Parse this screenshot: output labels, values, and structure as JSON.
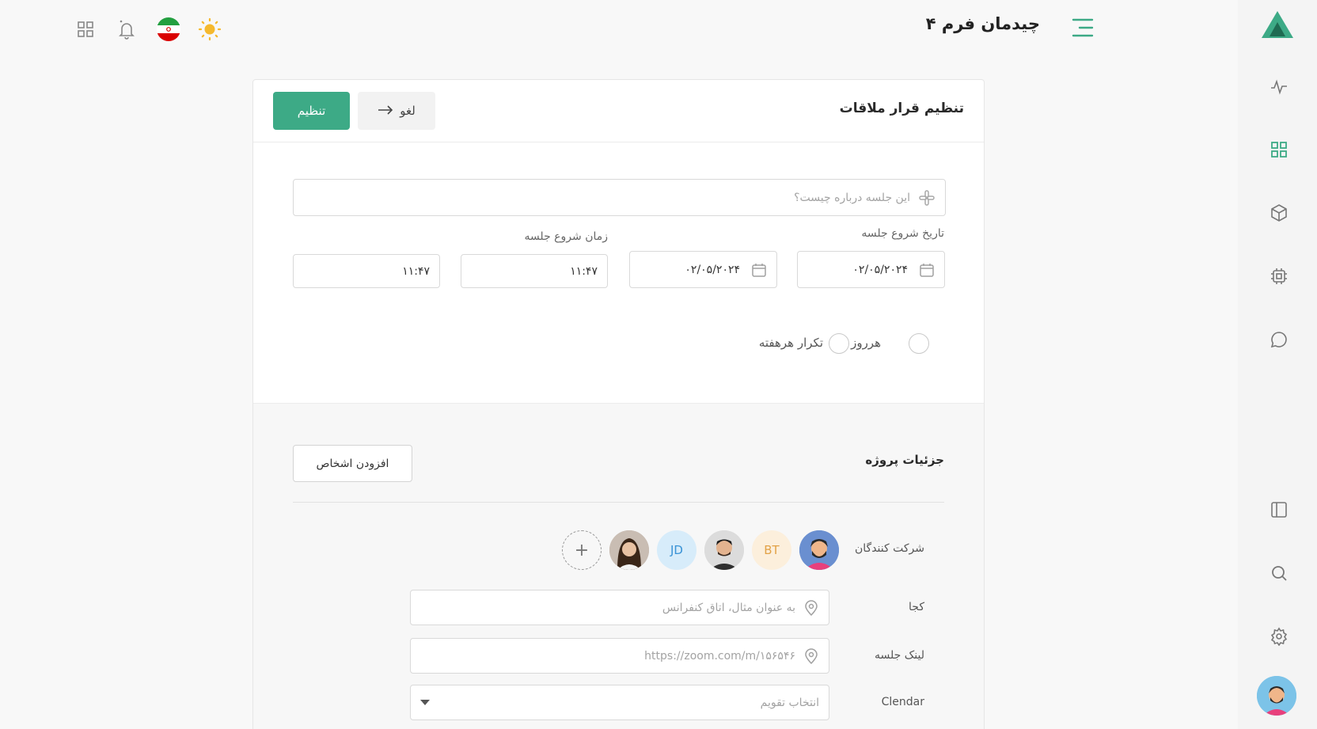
{
  "header": {
    "title": "چیدمان فرم ۴"
  },
  "card": {
    "title": "تنظیم قرار ملاقات",
    "set_button": "تنظیم",
    "cancel_button": "لغو",
    "about": {
      "placeholder": "این جلسه درباره چیست؟"
    },
    "start_date_label": "تاریخ شروع جلسه",
    "start_time_label": "زمان شروع جلسه",
    "dates": [
      "۰۲/۰۵/۲۰۲۴",
      "۰۲/۰۵/۲۰۲۴"
    ],
    "times": [
      "۱۱:۴۷",
      "۱۱:۴۷"
    ],
    "radio_daily": "هرروز",
    "radio_weekly": "تکرار هرهفته"
  },
  "project": {
    "title": "جزئیات پروژه",
    "add_people_button": "افزودن اشخاص",
    "participants_label": "شرکت کنندگان",
    "participants": [
      {
        "type": "photo",
        "name": "avatar-bearded-man"
      },
      {
        "type": "initials",
        "text": "BT",
        "bg": "#fcefdc",
        "color": "#e2a247"
      },
      {
        "type": "photo",
        "name": "avatar-man"
      },
      {
        "type": "initials",
        "text": "JD",
        "bg": "#d7ecfa",
        "color": "#3a93d6"
      },
      {
        "type": "photo",
        "name": "avatar-woman"
      }
    ],
    "where_label": "کجا",
    "where_placeholder": "به عنوان مثال، اتاق کنفرانس",
    "link_label": "لینک جلسه",
    "link_placeholder": "https://zoom.com/m/۱۵۶۵۴۶",
    "calendar_label": "Clendar",
    "calendar_placeholder": "انتخاب تقویم"
  },
  "colors": {
    "accent": "#3daa86",
    "sun": "#f5b92e"
  }
}
